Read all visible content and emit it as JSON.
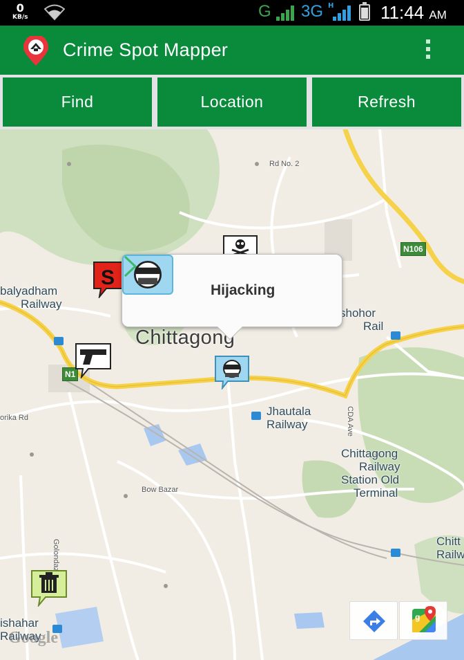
{
  "status_bar": {
    "network_speed": "0",
    "network_unit": "KB/s",
    "signal_g": "G",
    "signal_3g": "3G",
    "signal_h": "H",
    "time": "11:44",
    "ampm": "AM"
  },
  "app": {
    "title": "Crime Spot Mapper",
    "logo_icon": "crime-pin-icon",
    "menu_icon": "overflow-menu-icon",
    "accent": "#0a8b3c"
  },
  "buttons": {
    "find": "Find",
    "location": "Location",
    "refresh": "Refresh"
  },
  "map": {
    "city_label": "Chittagong",
    "labels": {
      "rd_no_2": "Rd No. 2",
      "n106": "N106",
      "n1": "N1",
      "balyadham_1": "balyadham",
      "balyadham_2": "Railway",
      "shohor_1": "shohor",
      "shohor_2": "Rail",
      "jhautala_1": "Jhautala",
      "jhautala_2": "Railway",
      "korika_rd": "orika Rd",
      "cda_ave": "CDA Ave",
      "ctg_station_1": "Chittagong",
      "ctg_station_2": "Railway",
      "ctg_station_3": "Station Old",
      "ctg_station_4": "Terminal",
      "bow_bazar": "Bow Bazar",
      "golondaz": "Golondaz R",
      "chitt_1": "Chitt",
      "chitt_2": "Railw",
      "ishahar_1": "ishahar",
      "ishahar_2": "Railway",
      "google": "Google"
    },
    "markers": [
      {
        "type": "hijacking",
        "icon": "hijacker-icon"
      },
      {
        "type": "death",
        "icon": "skull-icon"
      },
      {
        "type": "smuggling",
        "icon": "s-badge-icon"
      },
      {
        "type": "gun",
        "icon": "gun-icon"
      },
      {
        "type": "garbage",
        "icon": "trash-icon"
      }
    ],
    "popup": {
      "label": "Hijacking",
      "icon": "hijacker-icon",
      "arrow_icon": "chevron-right-icon"
    },
    "controls": {
      "directions_icon": "directions-icon",
      "google_maps_icon": "google-maps-icon"
    }
  }
}
